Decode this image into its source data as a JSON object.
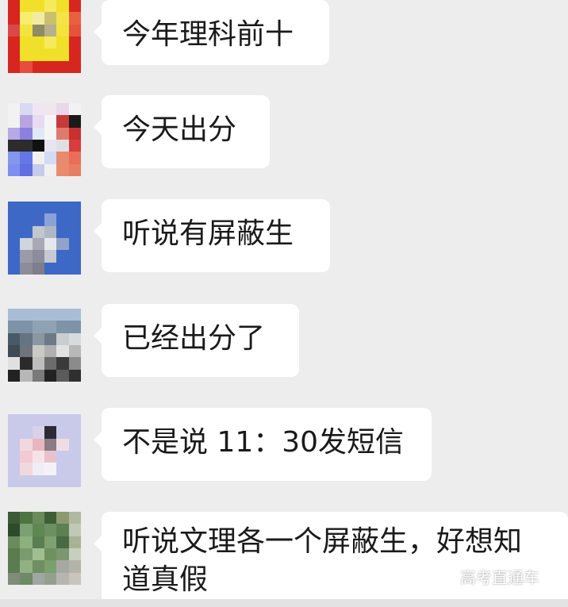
{
  "messages": [
    {
      "text": "今年理科前十",
      "avatar_colors": [
        "#d7261f",
        "#f1e02a",
        "#f1e02a",
        "#f5ea5c",
        "#f1e02a",
        "#d7261f",
        "#d7261f",
        "#f6ee6c",
        "#f4eba2",
        "#c8c06f",
        "#f3e548",
        "#e86042",
        "#d84a47",
        "#f2e33d",
        "#8f8b63",
        "#b7b08a",
        "#f2e33d",
        "#e6523c",
        "#d7261f",
        "#f1e02a",
        "#f1e02a",
        "#f5ea5c",
        "#f1e02a",
        "#d7261f",
        "#d7261f",
        "#f1e02a",
        "#f1e02a",
        "#f1e02a",
        "#f1e02a",
        "#d7261f",
        "#d7261f",
        "#e64d3a",
        "#d7261f",
        "#d7261f",
        "#d7261f",
        "#d7261f"
      ]
    },
    {
      "text": "今天出分",
      "avatar_colors": [
        "#f2f2f2",
        "#d9d9ef",
        "#f0e5f2",
        "#f2e6ee",
        "#e8d8e8",
        "#f2f2f2",
        "#f2f2f2",
        "#b8a5e0",
        "#e6dbf2",
        "#f5f5f5",
        "#c63a3a",
        "#1a1a1a",
        "#b6a9e8",
        "#8d7fe0",
        "#e0e8f5",
        "#f5f5f5",
        "#e07a6d",
        "#c93030",
        "#2c2c2c",
        "#2c2c2c",
        "#111111",
        "#e7e5f0",
        "#e0e0e0",
        "#d83c3c",
        "#8497ec",
        "#6377e6",
        "#f0f0f0",
        "#d3dbf5",
        "#e88a6f",
        "#e96d58",
        "#7c8ff0",
        "#5f6ee0",
        "#c6cbe9",
        "#f0f0f0",
        "#eb8a6f",
        "#e67e64"
      ]
    },
    {
      "text": "听说有屏蔽生",
      "avatar_colors": [
        "#3e68c6",
        "#3e68c6",
        "#3e68c6",
        "#3e68c6",
        "#3e68c6",
        "#3e68c6",
        "#3e68c6",
        "#3e68c6",
        "#3e68c6",
        "#8aa2d8",
        "#3e68c6",
        "#3e68c6",
        "#3e68c6",
        "#3e68c6",
        "#c2c6cf",
        "#b0b6c5",
        "#3e68c6",
        "#3e68c6",
        "#3e68c6",
        "#d0d4dd",
        "#a9a9b5",
        "#e7e8ec",
        "#93a2c8",
        "#3e68c6",
        "#3e68c6",
        "#9a9aa8",
        "#8c8c9a",
        "#c6c9d1",
        "#3e68c6",
        "#3e68c6",
        "#3e68c6",
        "#8c8c9a",
        "#7e7e8c",
        "#3e68c6",
        "#3e68c6",
        "#3e68c6"
      ]
    },
    {
      "text": "已经出分了",
      "avatar_colors": [
        "#a9bed6",
        "#a9bed6",
        "#a9bed6",
        "#a9bed6",
        "#a9bed6",
        "#a9bed6",
        "#7f93a6",
        "#7f93a6",
        "#8fa2b4",
        "#8fa2b4",
        "#7f93a6",
        "#7f93a6",
        "#4a5966",
        "#657482",
        "#8a96a0",
        "#6d7986",
        "#c8cdd2",
        "#d7dbe0",
        "#3f4a52",
        "#6e747a",
        "#c9c9c6",
        "#b0b0b0",
        "#e2e2e2",
        "#b8b9b6",
        "#e0e0e0",
        "#2b2b2b",
        "#bdbdbd",
        "#6b6b6b",
        "#3a3a3a",
        "#8b8b8b",
        "#222222",
        "#b7b7b7",
        "#7a7a7a",
        "#222222",
        "#5b5b5b",
        "#2f2f2f"
      ]
    },
    {
      "text": "不是说 11：30发短信",
      "avatar_colors": [
        "#c9c9ea",
        "#c9c9ea",
        "#c9c9ea",
        "#c9c9ea",
        "#c9c9ea",
        "#c9c9ea",
        "#c9c9ea",
        "#c9c9ea",
        "#d7d1ea",
        "#2d2a33",
        "#c9c9ea",
        "#c9c9ea",
        "#c9c9ea",
        "#f1d8dd",
        "#e9b6c0",
        "#8a7d85",
        "#f0dde4",
        "#c9c9ea",
        "#c9c9ea",
        "#f3c9d2",
        "#f6e3e8",
        "#e8c2ca",
        "#c9c9ea",
        "#c9c9ea",
        "#c9c9ea",
        "#f1d8dd",
        "#f0eef5",
        "#f5f2f7",
        "#c9c9ea",
        "#c9c9ea",
        "#c9c9ea",
        "#c9c9ea",
        "#c9c9ea",
        "#c9c9ea",
        "#c9c9ea",
        "#c9c9ea"
      ]
    },
    {
      "text_lines": [
        "听说文理各一个屏蔽生，好想知",
        "道真假"
      ],
      "avatar_colors": [
        "#3b5a35",
        "#4e7440",
        "#6a8c5a",
        "#3f5e38",
        "#8a9a6e",
        "#b0b8a0",
        "#2d4a2a",
        "#7aa073",
        "#5e8851",
        "#6c9061",
        "#5d7f52",
        "#c0c9b5",
        "#6a8b5b",
        "#8cb080",
        "#5b7d52",
        "#7fa071",
        "#486a43",
        "#a8b295",
        "#5a7c4e",
        "#7a9b6d",
        "#9fbf92",
        "#6f915f",
        "#7a9770",
        "#c7cfbd",
        "#5b7c50",
        "#91b184",
        "#6d8f62",
        "#7aa06d",
        "#a6a9a2",
        "#b2b4a9",
        "#7d8d77",
        "#6f8a66",
        "#a0a6a0",
        "#94a08d",
        "#b8b5b0",
        "#c9c5be"
      ]
    }
  ],
  "watermark": "高考直通车"
}
